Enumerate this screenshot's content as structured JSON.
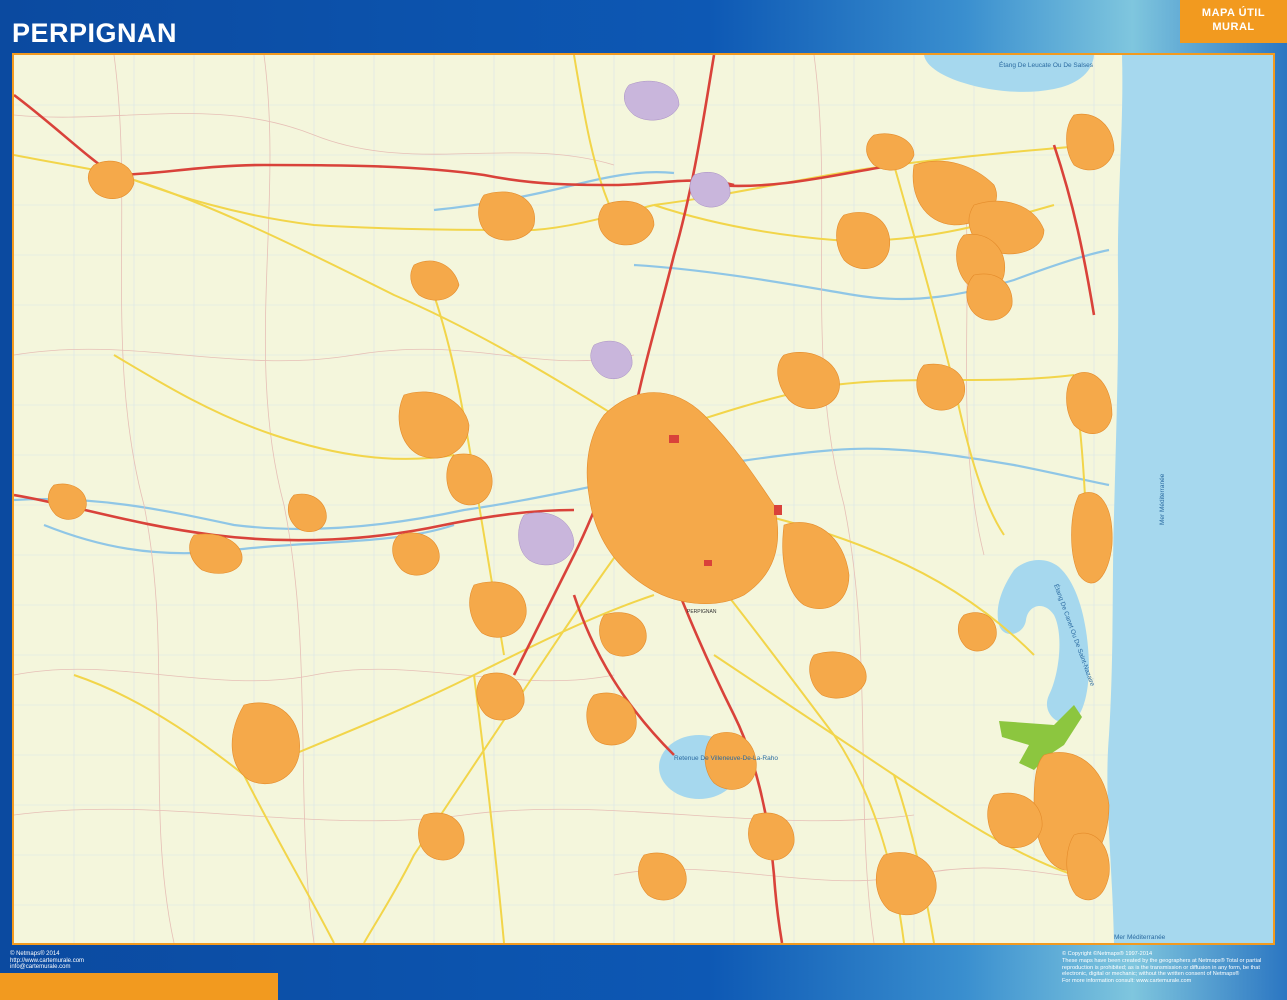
{
  "header": {
    "title": "PERPIGNAN",
    "badge_line1": "MAPA ÚTIL",
    "badge_line2": "MURAL"
  },
  "map": {
    "city_label": "PERPIGNAN",
    "water_labels": {
      "leucate": "Étang De Leucate Ou De Salses",
      "canet": "Étang De Canet Ou De Saint-Nazaire",
      "reservoir": "Retenue De Villeneuve-De-La-Raho",
      "sea": "Mer Méditerranée",
      "sea_south": "Mer Méditerranée"
    }
  },
  "footer": {
    "left_line1": "© Netmaps® 2014",
    "left_line2": "http://www.cartemurale.com",
    "left_line3": "info@cartemurale.com",
    "right_line1": "© Copyright ©Netmaps® 1997-2014",
    "right_line2": "These maps have been created by the geographers at Netmaps® Total or partial",
    "right_line3": "reproduction is prohibited; as is the transmission or diffusion in any form, be that",
    "right_line4": "electronic, digital or mechanic; without the written consent of Netmaps®",
    "right_line5": "For more information consult: www.cartemurale.com"
  },
  "colors": {
    "frame_blue": "#0d4fa3",
    "accent_orange": "#f29a1f",
    "land": "#f4f6dc",
    "sea": "#a6d8ee",
    "urban": "#f5a94a",
    "road_yellow": "#f2d54a",
    "road_red": "#d9423a",
    "river": "#8fc6e6",
    "park_green": "#8cc63f"
  }
}
